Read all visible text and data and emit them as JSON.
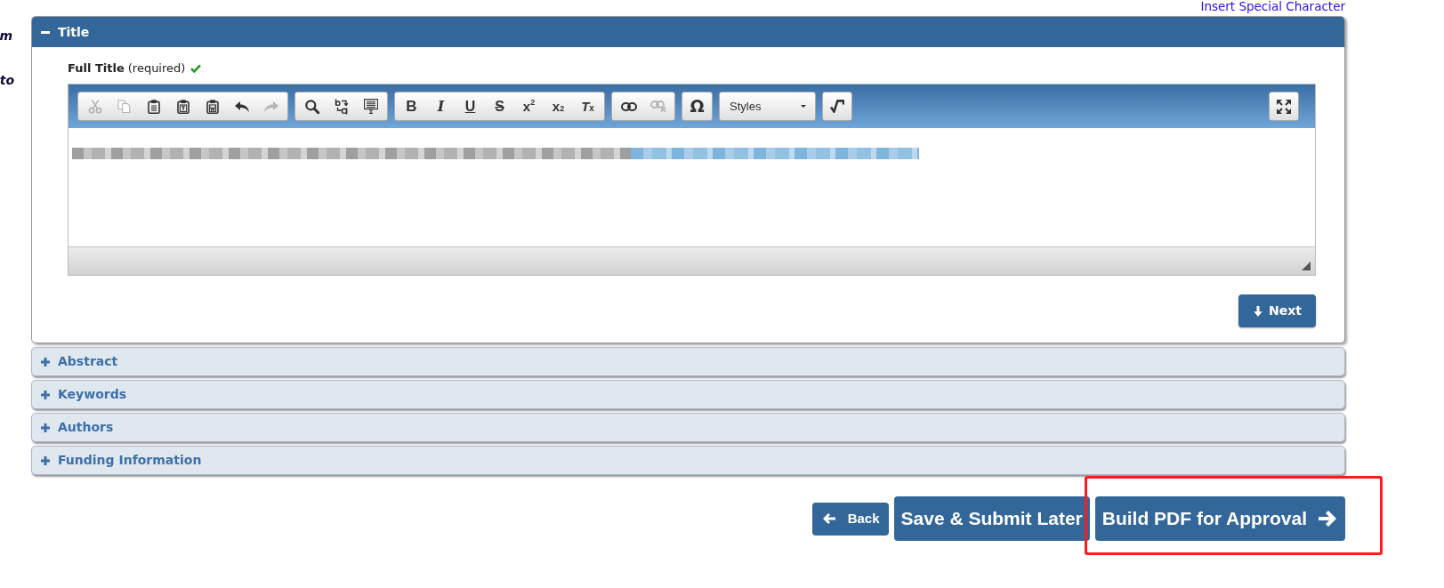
{
  "left_margin_texts": [
    "m",
    "to"
  ],
  "top_link": "Insert Special Character",
  "sections": [
    {
      "title": "Title",
      "expanded": true,
      "field": {
        "label": "Full Title",
        "note": "(required)",
        "valid": true,
        "toolbar": [
          [
            {
              "kind": "cut",
              "disabled": true
            },
            {
              "kind": "copy",
              "disabled": true
            },
            {
              "kind": "paste",
              "disabled": false
            },
            {
              "kind": "paste-text",
              "disabled": false
            },
            {
              "kind": "paste-word",
              "disabled": false
            },
            {
              "kind": "undo",
              "disabled": false
            },
            {
              "kind": "redo",
              "disabled": true
            }
          ],
          [
            {
              "kind": "find",
              "disabled": false
            },
            {
              "kind": "replace",
              "disabled": false
            },
            {
              "kind": "select-all",
              "disabled": false
            }
          ],
          [
            {
              "kind": "bold",
              "label": "B",
              "disabled": false
            },
            {
              "kind": "italic",
              "label": "I",
              "disabled": false
            },
            {
              "kind": "underline",
              "label": "U",
              "disabled": false
            },
            {
              "kind": "strike",
              "label": "S",
              "disabled": false
            },
            {
              "kind": "superscript",
              "label": "x$^{2}$",
              "disabled": false
            },
            {
              "kind": "subscript",
              "label": "x$_{2}$",
              "disabled": false
            },
            {
              "kind": "remove-format",
              "label": "*T*$_{x}$",
              "disabled": false
            }
          ],
          [
            {
              "kind": "link",
              "disabled": false
            },
            {
              "kind": "unlink",
              "disabled": true
            }
          ],
          [
            {
              "kind": "symbol",
              "label": "Ω",
              "disabled": false
            }
          ],
          [
            {
              "kind": "dropdown",
              "label": "Styles",
              "disabled": false
            }
          ],
          [
            {
              "kind": "math",
              "disabled": false
            }
          ]
        ],
        "toolbar_right": [
          {
            "kind": "maximize",
            "disabled": false
          }
        ],
        "next_button": "Next"
      }
    },
    {
      "title": "Abstract",
      "expanded": false
    },
    {
      "title": "Keywords",
      "expanded": false
    },
    {
      "title": "Authors",
      "expanded": false
    },
    {
      "title": "Funding Information",
      "expanded": false
    }
  ],
  "footer_buttons": [
    {
      "kind": "back",
      "label": "Back",
      "highlighted": false
    },
    {
      "kind": "plain",
      "label": "Save & Submit Later",
      "highlighted": false
    },
    {
      "kind": "forward",
      "label": "Build PDF for Approval",
      "highlighted": true
    }
  ]
}
